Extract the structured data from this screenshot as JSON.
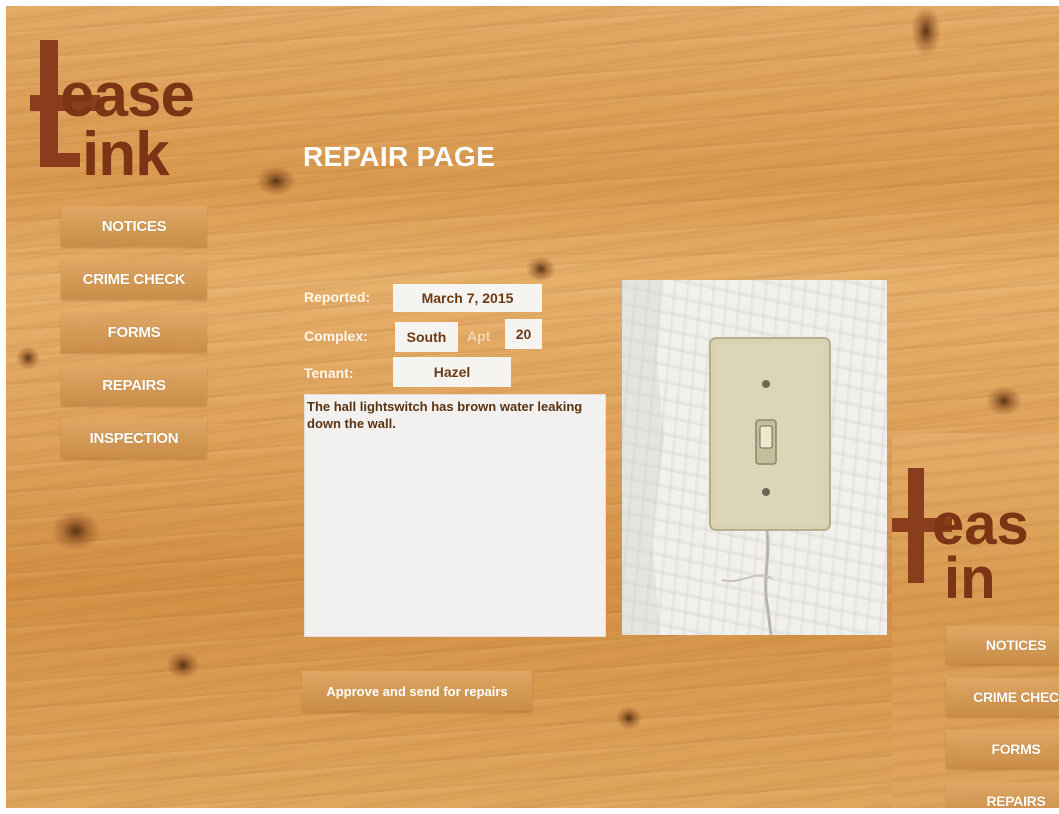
{
  "app": {
    "logo_line1": "ease",
    "logo_line2": "ink"
  },
  "nav": [
    {
      "label": "NOTICES"
    },
    {
      "label": "CRIME CHECK"
    },
    {
      "label": "FORMS"
    },
    {
      "label": "REPAIRS"
    },
    {
      "label": "INSPECTION"
    }
  ],
  "page": {
    "title": "REPAIR PAGE"
  },
  "form": {
    "reported_label": "Reported:",
    "reported_value": "March 7, 2015",
    "complex_label": "Complex:",
    "complex_value": "South",
    "apt_label": "Apt",
    "apt_value": "20",
    "tenant_label": "Tenant:",
    "tenant_value": "Hazel",
    "description": "The hall lightswitch has brown water leaking down the wall."
  },
  "photo": {
    "subject": "light-switch-photo"
  },
  "actions": {
    "approve_label": "Approve and send for repairs"
  },
  "duplicate": {
    "logo_line1": "eas",
    "logo_line2": "in",
    "nav": [
      {
        "label": "NOTICES"
      },
      {
        "label": "CRIME CHEC"
      },
      {
        "label": "FORMS"
      },
      {
        "label": "REPAIRS"
      }
    ]
  },
  "colors": {
    "logo_brown": "#7c3414",
    "text_brown": "#6b3a14",
    "wood_base": "#dea15a"
  }
}
